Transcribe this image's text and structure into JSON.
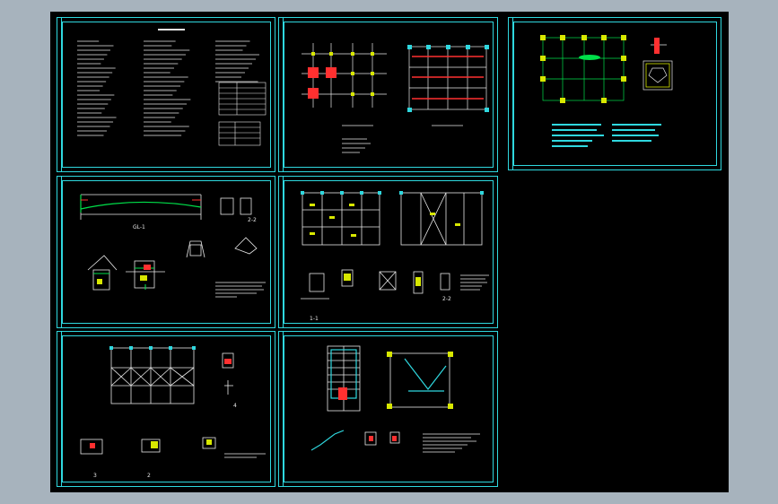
{
  "colors": {
    "window_bg": "#a7b3bd",
    "canvas_bg": "#000000",
    "frame": "#2fd8df",
    "line": "#e8e8e8",
    "column": "#d8e800",
    "highlight": "#ff3030",
    "accent": "#00e04a"
  },
  "sheets": [
    {
      "id": "design-notes"
    },
    {
      "id": "foundation-plan"
    },
    {
      "id": "foundation-detail"
    },
    {
      "id": "beam-elevation"
    },
    {
      "id": "floor-framing"
    },
    {
      "id": "roof-truss"
    },
    {
      "id": "stair-detail"
    }
  ],
  "labels": {
    "beam_section": "2-2",
    "beam_mark": "GL-1",
    "section_1": "1",
    "section_2": "2",
    "section_3": "3",
    "section_4": "4",
    "stair_section": "1-1",
    "frame_section": "2-2"
  }
}
